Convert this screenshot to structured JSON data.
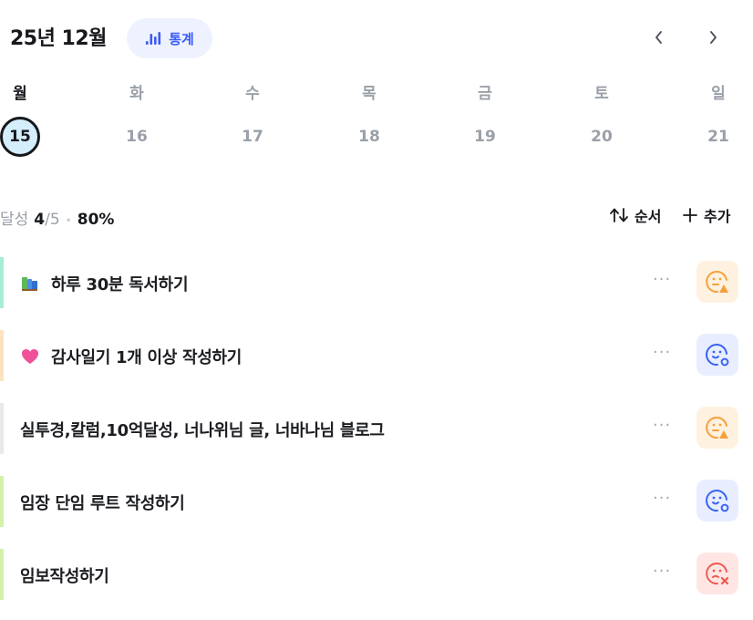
{
  "header": {
    "month_title": "25년 12월",
    "stats_label": "통계",
    "prev_icon": "chevron-left-icon",
    "next_icon": "chevron-right-icon"
  },
  "week": {
    "days": [
      {
        "label": "월",
        "date": "15",
        "selected": true
      },
      {
        "label": "화",
        "date": "16",
        "selected": false
      },
      {
        "label": "수",
        "date": "17",
        "selected": false
      },
      {
        "label": "목",
        "date": "18",
        "selected": false
      },
      {
        "label": "금",
        "date": "19",
        "selected": false
      },
      {
        "label": "토",
        "date": "20",
        "selected": false
      },
      {
        "label": "일",
        "date": "21",
        "selected": false
      }
    ]
  },
  "summary": {
    "label": "달성",
    "done": "4",
    "total": "/5",
    "percent": "80%"
  },
  "toolbar": {
    "order_label": "순서",
    "add_label": "추가"
  },
  "tasks": [
    {
      "emoji": "books-icon",
      "title": "하루 30분 독서하기",
      "accent": "#a7ecd6",
      "mood": "neutral",
      "more": "···"
    },
    {
      "emoji": "heart-icon",
      "title": "감사일기 1개 이상 작성하기",
      "accent": "#fde2c2",
      "mood": "happy",
      "more": "···"
    },
    {
      "emoji": "",
      "title": "실투경,칼럼,10억달성, 너나위님 글, 너바나님 블로그",
      "accent": "#e8e9ec",
      "mood": "neutral",
      "more": "···"
    },
    {
      "emoji": "",
      "title": "임장 단임 루트 작성하기",
      "accent": "#d4f0a9",
      "mood": "happy",
      "more": "···"
    },
    {
      "emoji": "",
      "title": "임보작성하기",
      "accent": "#d4f0a9",
      "mood": "bad",
      "more": "···"
    }
  ],
  "colors": {
    "accent_blue": "#3b5bf5",
    "mood_neutral_bg": "#fff1df",
    "mood_neutral_fg": "#f5a13a",
    "mood_happy_bg": "#e8eeff",
    "mood_happy_fg": "#3b63f5",
    "mood_bad_bg": "#ffe6e4",
    "mood_bad_fg": "#ee5a4f"
  }
}
